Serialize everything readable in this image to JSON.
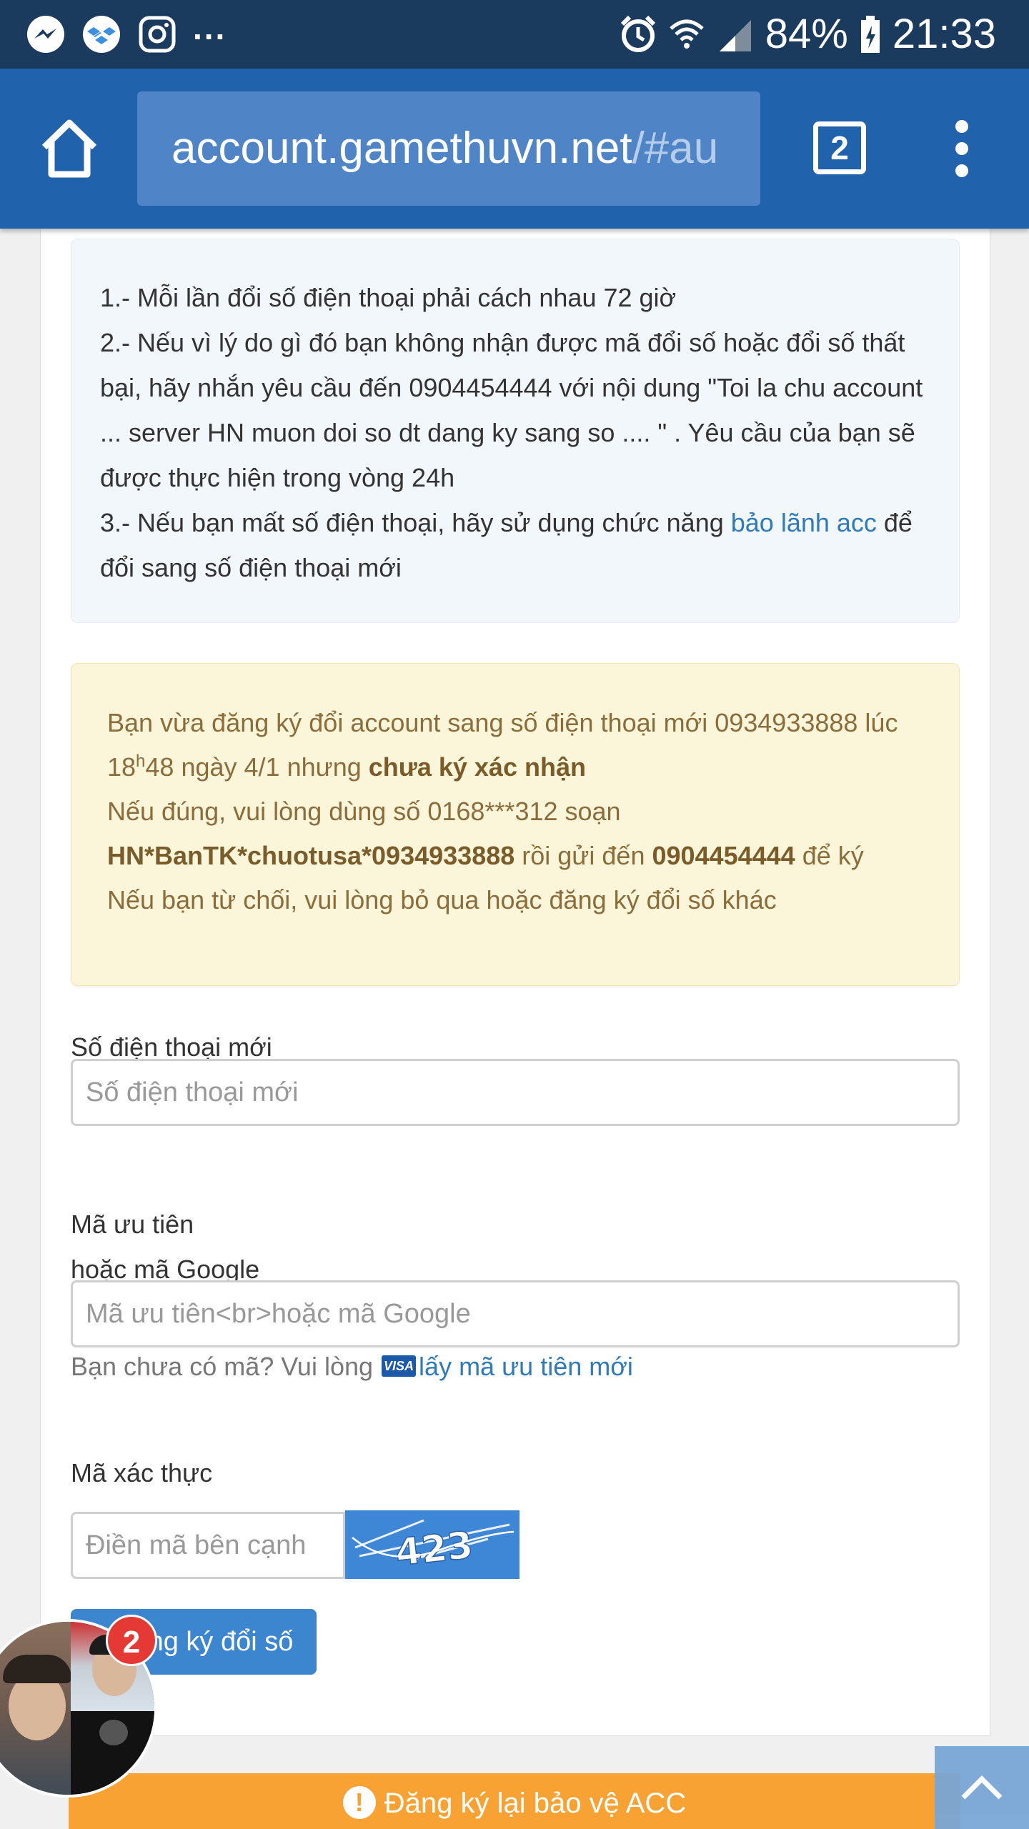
{
  "status_bar": {
    "battery": "84%",
    "time": "21:33",
    "more": "..."
  },
  "browser": {
    "url_host": "account.gamethuvn.net",
    "url_rest": "/#au",
    "tab_count": "2"
  },
  "notice": {
    "line1": "1.- Mỗi lần đổi số điện thoại phải cách nhau 72 giờ",
    "line2": "2.- Nếu vì lý do gì đó bạn không nhận được mã đổi số hoặc đổi số thất bại, hãy nhắn yêu cầu đến 0904454444 với nội dung \"Toi la chu account ... server HN muon doi so dt dang ky sang so .... \" . Yêu cầu của bạn sẽ được thực hiện trong vòng 24h",
    "line3_pre": "3.- Nếu bạn mất số điện thoại, hãy sử dụng chức năng ",
    "line3_link": "bảo lãnh acc",
    "line3_post": " để đổi sang số điện thoại mới"
  },
  "warning": {
    "l1": "Bạn vừa đăng ký đổi account sang số điện thoại mới 0934933888 lúc 18",
    "l1_sup": "h",
    "l1b": "48 ngày 4/1 nhưng ",
    "l1_bold": "chưa ký xác nhận",
    "l2": "Nếu đúng, vui lòng dùng số 0168***312 soạn",
    "l3_bold": "HN*BanTK*chuotusa*0934933888",
    "l3_mid": " rồi gửi đến ",
    "l3_bold2": "0904454444",
    "l3_post": " để ký",
    "l4": "Nếu bạn từ chối, vui lòng bỏ qua hoặc đăng ký đổi số khác"
  },
  "form": {
    "phone_label": "Số điện thoại mới",
    "phone_placeholder": "Số điện thoại mới",
    "code_label_1": "Mã ưu tiên",
    "code_label_2": "hoặc mã Google",
    "code_placeholder": "Mã ưu tiên<br>hoặc mã Google",
    "hint_pre": "Bạn chưa có mã? Vui lòng",
    "hint_icon": "VISA",
    "hint_link": "lấy mã ưu tiên mới",
    "captcha_label": "Mã xác thực",
    "captcha_placeholder": "Điền mã bên cạnh",
    "captcha_text": "423",
    "submit_label": "Đăng ký đổi số"
  },
  "banner": {
    "icon": "!",
    "text": "Đăng ký lại bảo vệ ACC"
  },
  "chat_head": {
    "badge": "2"
  },
  "icons": [
    "messenger-icon",
    "dropbox-icon",
    "instagram-icon",
    "alarm-icon",
    "wifi-icon",
    "signal-icon",
    "battery-icon",
    "home-icon",
    "menu-icon",
    "visa-icon",
    "alert-icon",
    "chevron-up-icon"
  ],
  "colors": {
    "toolbar": "#2162ad",
    "link": "#2f7ab9",
    "banner": "#f7a232",
    "warning_bg": "#fbf5d9",
    "notice_bg": "#f2f7fc"
  }
}
